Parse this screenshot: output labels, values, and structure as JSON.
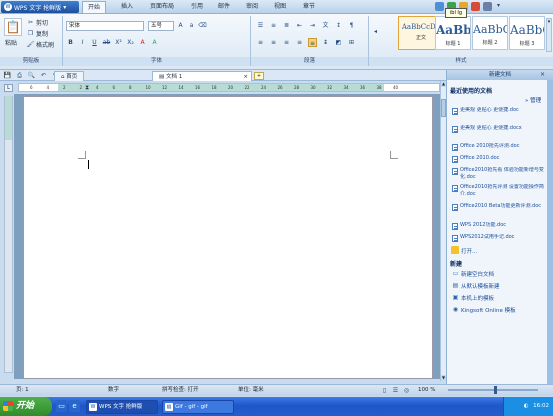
{
  "app": {
    "title": "WPS 文字 抢鲜版",
    "logo": "W"
  },
  "menu": {
    "tabs": [
      "开始",
      "插入",
      "页面布局",
      "引用",
      "邮件",
      "审阅",
      "视图",
      "章节"
    ],
    "active": "开始"
  },
  "tooltip": "ibl Ig",
  "title_icons": {
    "colors": [
      "#4f8fd8",
      "#3aa24a",
      "#e4a92c",
      "#d84a3a",
      "#6c7fa6"
    ]
  },
  "ribbon": {
    "paste_label": "粘贴",
    "cut_label": "剪切",
    "copy_label": "复制",
    "format_painter_label": "格式刷",
    "font_name": "宋体",
    "font_size": "五号",
    "font_buttons": [
      "B",
      "I",
      "U",
      "ab",
      "X²",
      "X₂",
      "A",
      "A"
    ],
    "groups": [
      "剪贴板",
      "字体",
      "段落",
      "样式"
    ],
    "styles": [
      {
        "sample": "AaBbCcDd",
        "name": "正文"
      },
      {
        "sample": "AaBb",
        "name": "标题 1"
      },
      {
        "sample": "AaBbC",
        "name": "标题 2"
      },
      {
        "sample": "AaBbC",
        "name": "标题 3"
      }
    ]
  },
  "doc_tabs": [
    {
      "label": "首页"
    },
    {
      "label": "文档 1"
    }
  ],
  "ruler": {
    "ticks": [
      "6",
      "4",
      "2",
      "2",
      "4",
      "6",
      "8",
      "10",
      "12",
      "14",
      "16",
      "18",
      "20",
      "22",
      "24",
      "26",
      "28",
      "30",
      "32",
      "34",
      "36",
      "38",
      "40"
    ]
  },
  "task_pane": {
    "header": "新建文档",
    "recent_title": "最近使用的文档",
    "manage_label": "管理",
    "recent_files": [
      "更美观 更贴心 更便捷.doc",
      "更美观 更贴心 更便捷.docx",
      "Office 2010抢先评测.doc",
      "Office 2010.doc",
      "Office2010抢先看 体验功能新增与变化.doc",
      "Office2010抢先评测 设置功能操作简介.doc",
      "Office2010 Beta功能更新评测.doc",
      "WPS 2012功能.doc",
      "WPS2012试用手记.doc"
    ],
    "open_label": "打开...",
    "new_title": "新建",
    "new_items": [
      "新建空白文档",
      "从默认模板新建",
      "本机上的模板",
      "Kingsoft Online 模板"
    ]
  },
  "status": {
    "page": "页: 1",
    "items": [
      "数字",
      "拼写检查: 打开",
      "单位: 毫米"
    ],
    "zoom": "100 %"
  },
  "taskbar": {
    "start": "开始",
    "buttons": [
      "WPS 文字 抢鲜版",
      "Gif - gif - gif"
    ],
    "clock": "16:02"
  }
}
